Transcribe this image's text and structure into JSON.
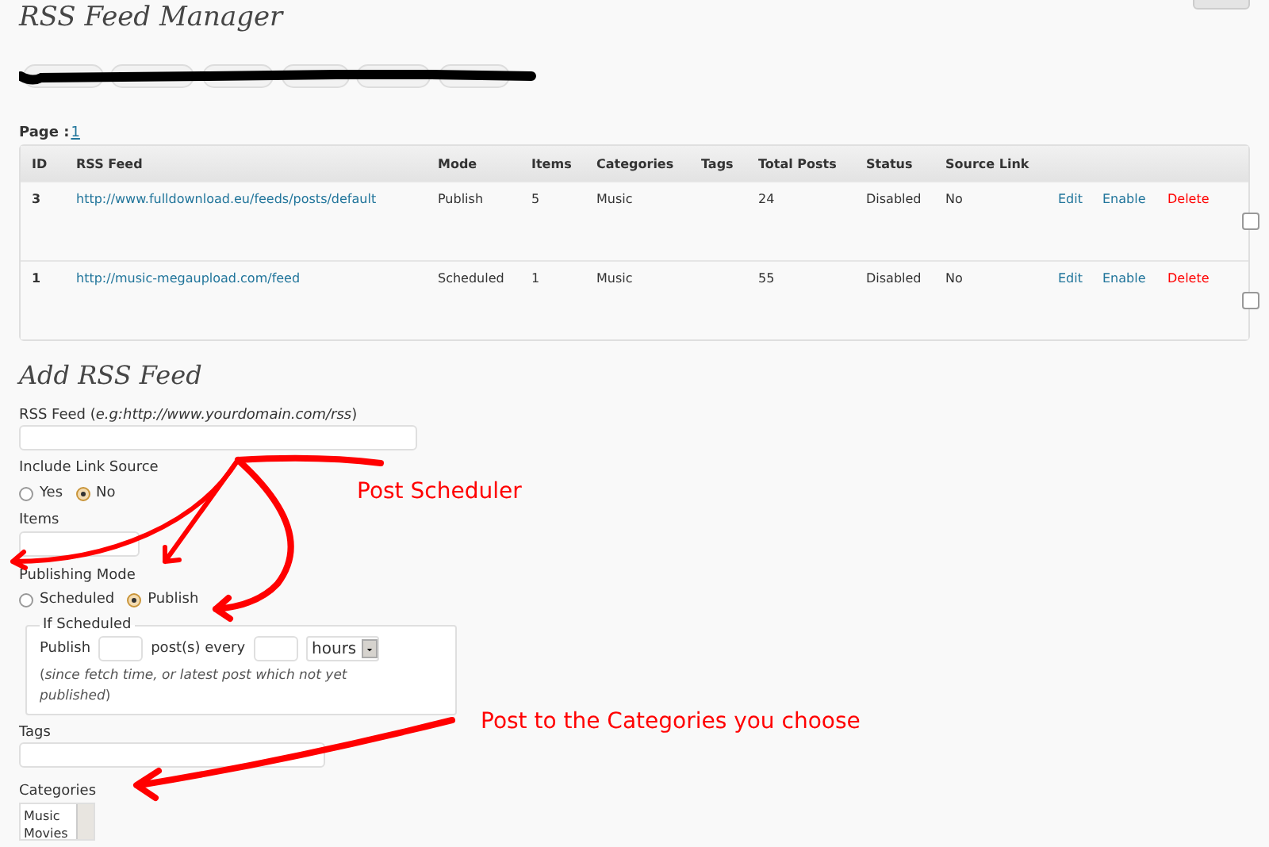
{
  "page_title": "RSS Feed Manager",
  "pagination": {
    "label": "Page :",
    "pages": [
      {
        "label": "1",
        "selected": true
      }
    ]
  },
  "table": {
    "columns": [
      "ID",
      "RSS Feed",
      "Mode",
      "Items",
      "Categories",
      "Tags",
      "Total Posts",
      "Status",
      "Source Link"
    ],
    "rows": [
      {
        "id": "3",
        "feed": "http://www.fulldownload.eu/feeds/posts/default",
        "mode": "Publish",
        "items": "5",
        "categories": "Music",
        "total_posts": "24",
        "status": "Disabled",
        "source_link": "No",
        "actions": [
          {
            "label": "Edit",
            "kind": "link"
          },
          {
            "label": "Enable",
            "kind": "link"
          },
          {
            "label": "Delete",
            "kind": "danger"
          }
        ],
        "checked": false
      },
      {
        "id": "1",
        "feed": "http://music-megaupload.com/feed",
        "mode": "Scheduled",
        "items": "1",
        "categories": "Music",
        "total_posts": "55",
        "status": "Disabled",
        "source_link": "No",
        "actions": [
          {
            "label": "Edit",
            "kind": "link"
          },
          {
            "label": "Enable",
            "kind": "link"
          },
          {
            "label": "Delete",
            "kind": "danger"
          }
        ],
        "checked": false
      }
    ]
  },
  "form": {
    "title": "Add RSS Feed",
    "feed_label": "RSS Feed (*e.g:http://www.yourdomain.com/rss*)",
    "link_source": {
      "label": "Include Link Source",
      "options": [
        {
          "label": "Yes",
          "selected": false
        },
        {
          "label": "No",
          "selected": true
        }
      ]
    },
    "items_label": "Items",
    "mode": {
      "label": "Publishing Mode",
      "options": [
        {
          "label": "Scheduled",
          "selected": false
        },
        {
          "label": "Publish",
          "selected": true
        }
      ]
    },
    "schedule": {
      "legend": "If Scheduled",
      "publish_label": "Publish",
      "every_label": "post(s) every",
      "unit": "hours",
      "note": "(*since fetch time, or latest post which not yet published*)"
    },
    "tags_label": "Tags",
    "categories": {
      "label": "Categories",
      "options": [
        "Music",
        "Movies"
      ]
    }
  },
  "annotations": [
    {
      "text": "Post Scheduler"
    },
    {
      "text": "Post to the Categories you choose"
    }
  ]
}
